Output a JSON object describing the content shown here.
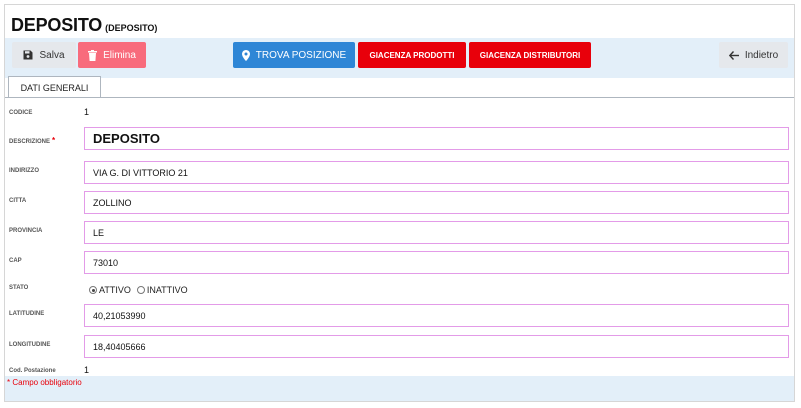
{
  "header": {
    "title": "DEPOSITO",
    "subtitle": "(DEPOSITO)"
  },
  "toolbar": {
    "save_label": "Salva",
    "delete_label": "Elimina",
    "find_position_label": "TROVA POSIZIONE",
    "stock_products_label": "GIACENZA PRODOTTI",
    "stock_distributors_label": "GIACENZA DISTRIBUTORI",
    "back_label": "Indietro"
  },
  "tabs": [
    {
      "label": "DATI GENERALI",
      "active": true
    }
  ],
  "form": {
    "codice": {
      "label": "CODICE",
      "value": "1"
    },
    "descrizione": {
      "label": "DESCRIZIONE",
      "required_mark": "*",
      "value": "DEPOSITO"
    },
    "indirizzo": {
      "label": "INDIRIZZO",
      "value": "VIA G. DI VITTORIO 21"
    },
    "citta": {
      "label": "CITTA",
      "value": "ZOLLINO"
    },
    "provincia": {
      "label": "PROVINCIA",
      "value": "LE"
    },
    "cap": {
      "label": "CAP",
      "value": "73010"
    },
    "stato": {
      "label": "STATO",
      "options": [
        {
          "label": "ATTIVO",
          "selected": true
        },
        {
          "label": "INATTIVO",
          "selected": false
        }
      ]
    },
    "latitudine": {
      "label": "LATITUDINE",
      "value": "40,21053990"
    },
    "longitudine": {
      "label": "LONGITUDINE",
      "value": "18,40405666"
    },
    "cod_postazione": {
      "label": "Cod. Postazione",
      "value": "1"
    }
  },
  "footer": {
    "required_note": "* Campo obbligatorio"
  },
  "colors": {
    "toolbar_bg": "#e3eff9",
    "danger_soft": "#f86b7c",
    "primary": "#2e86d6",
    "danger": "#e8000b",
    "field_border": "#e39be8"
  },
  "icons": {
    "save": "floppy-disk-icon",
    "delete": "trash-icon",
    "find_position": "map-marker-icon",
    "back": "arrow-left-icon"
  }
}
